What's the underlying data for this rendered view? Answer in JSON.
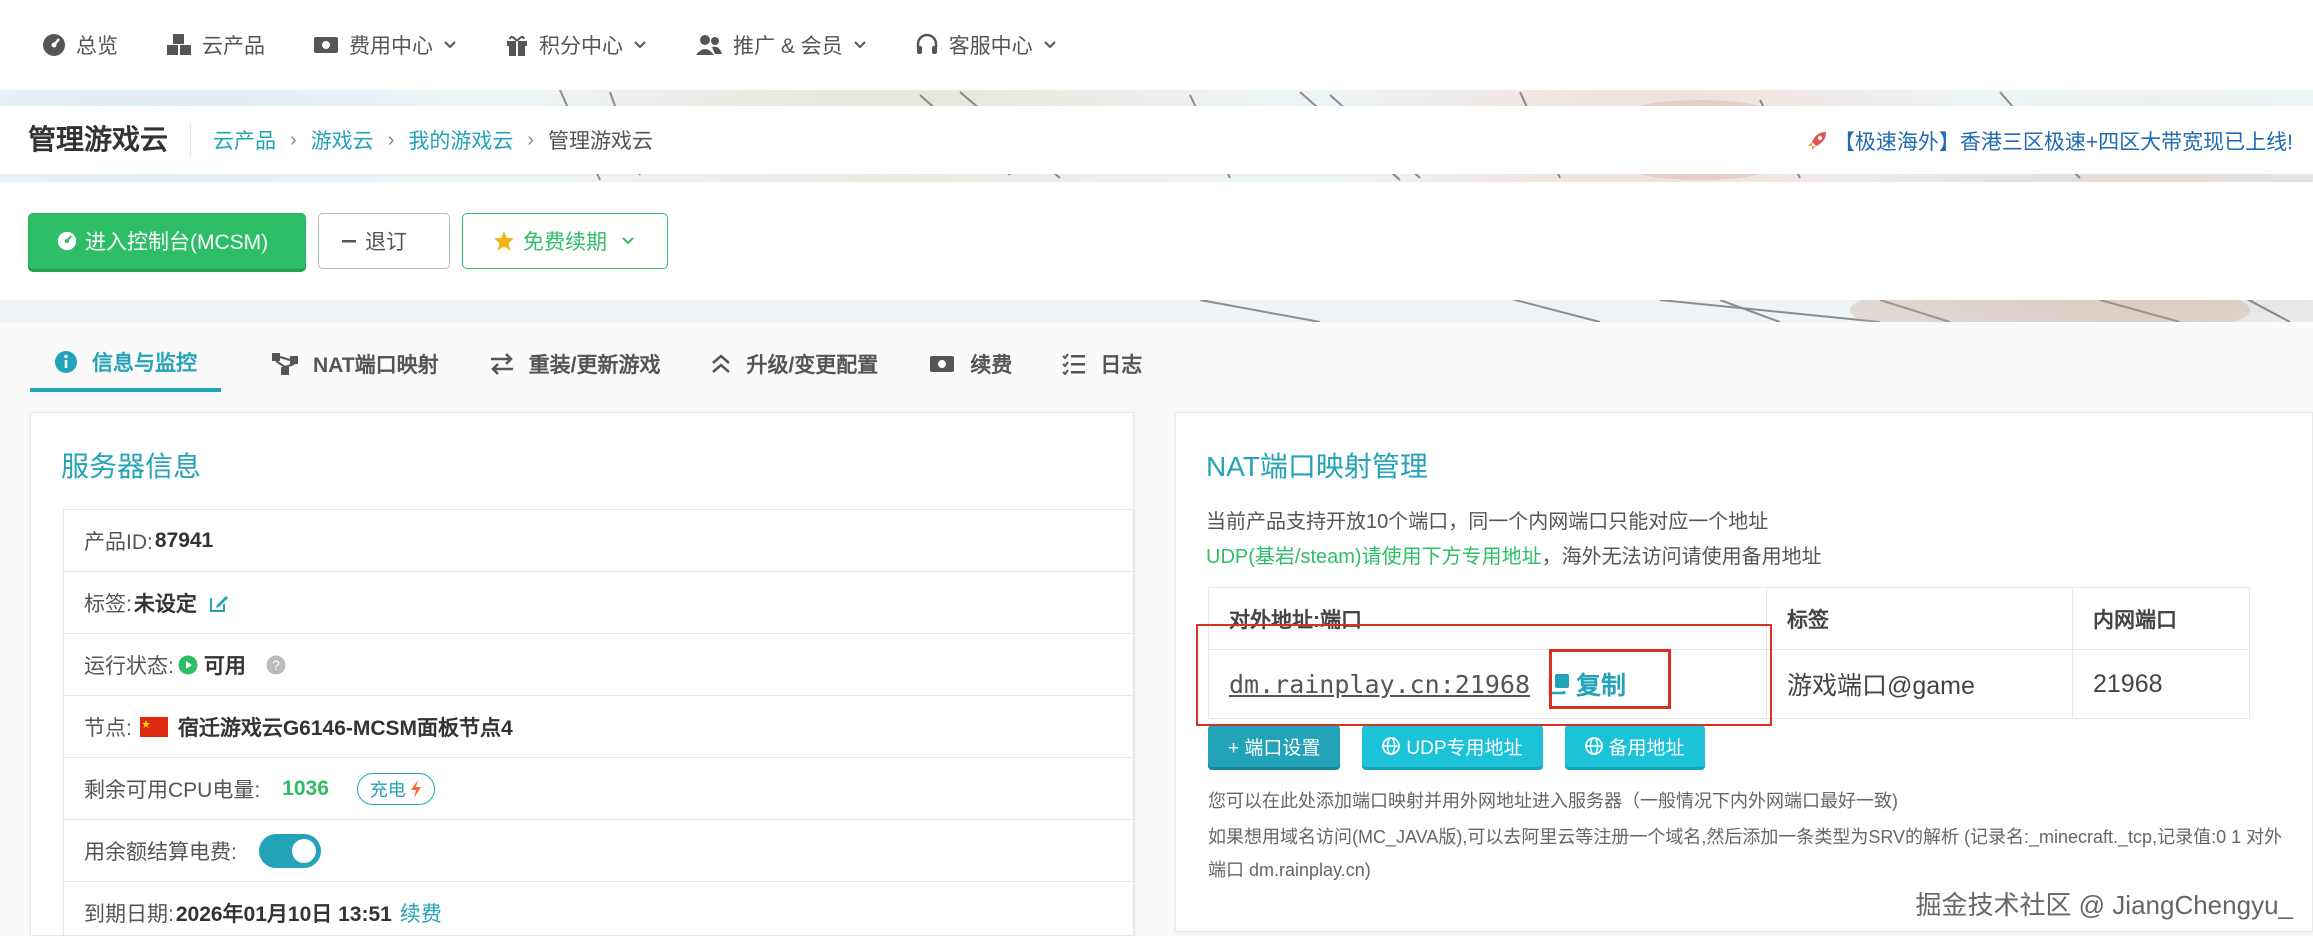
{
  "nav": {
    "items": [
      {
        "label": "总览",
        "icon": "dashboard-icon"
      },
      {
        "label": "云产品",
        "icon": "cubes-icon"
      },
      {
        "label": "费用中心",
        "icon": "money-icon"
      },
      {
        "label": "积分中心",
        "icon": "gift-icon"
      },
      {
        "label": "推广 & 会员",
        "icon": "users-icon"
      },
      {
        "label": "客服中心",
        "icon": "headset-icon"
      }
    ]
  },
  "header": {
    "title": "管理游戏云",
    "breadcrumb": [
      "云产品",
      "游戏云",
      "我的游戏云",
      "管理游戏云"
    ],
    "notice": "【极速海外】香港三区极速+四区大带宽现已上线!"
  },
  "actions": {
    "console": "进入控制台(MCSM)",
    "refund": "退订",
    "renew": "免费续期"
  },
  "tabs": [
    "信息与监控",
    "NAT端口映射",
    "重装/更新游戏",
    "升级/变更配置",
    "续费",
    "日志"
  ],
  "server": {
    "title": "服务器信息",
    "product_id_label": "产品ID:",
    "product_id": "87941",
    "tag_label": "标签:",
    "tag": "未设定",
    "status_label": "运行状态:",
    "status": "可用",
    "node_label": "节点:",
    "node": "宿迁游戏云G6146-MCSM面板节点4",
    "cpu_label": "剩余可用CPU电量:",
    "cpu": "1036",
    "charge": "充电",
    "balance_label": "用余额结算电费:",
    "expire_label": "到期日期:",
    "expire": "2026年01月10日 13:51",
    "renew_link": "续费"
  },
  "nat": {
    "title": "NAT端口映射管理",
    "desc1": "当前产品支持开放10个端口，同一个内网端口只能对应一个地址",
    "desc2_hl": "UDP(基岩/steam)请使用下方专用地址",
    "desc2_rest": "，海外无法访问请使用备用地址",
    "columns": [
      "对外地址:端口",
      "标签",
      "内网端口"
    ],
    "rows": [
      {
        "address": "dm.rainplay.cn:21968",
        "tag": "游戏端口@game",
        "inner": "21968"
      }
    ],
    "copy": "复制",
    "btn_port": "+ 端口设置",
    "btn_udp": "UDP专用地址",
    "btn_backup": "备用地址",
    "note1": "您可以在此处添加端口映射并用外网地址进入服务器（一般情况下内外网端口最好一致)",
    "note2": "如果想用域名访问(MC_JAVA版),可以去阿里云等注册一个域名,然后添加一条类型为SRV的解析 (记录名:_minecraft._tcp,记录值:0 1 对外端口 dm.rainplay.cn)"
  },
  "watermark": "掘金技术社区 @ JiangChengyu_"
}
